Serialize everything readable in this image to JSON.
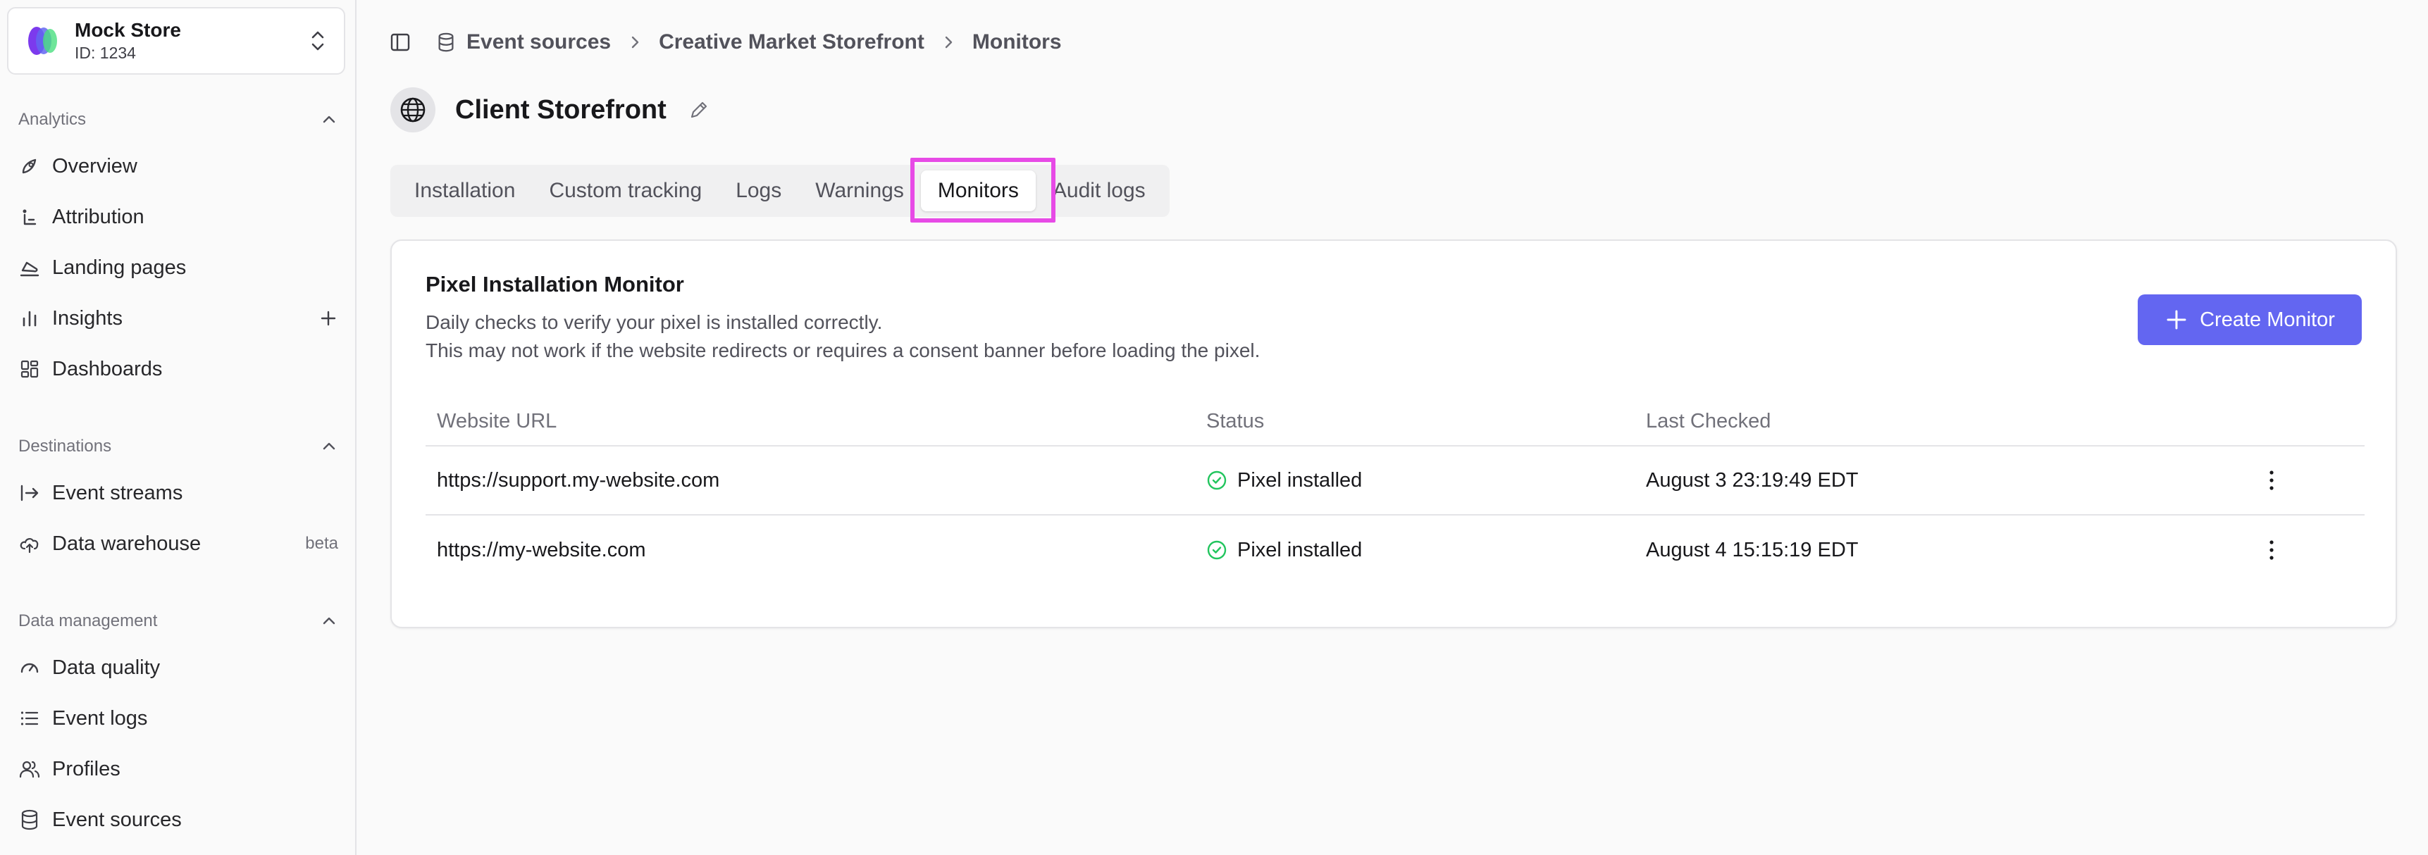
{
  "store": {
    "name": "Mock Store",
    "id_label": "ID: 1234"
  },
  "sidebar": {
    "sections": [
      {
        "label": "Analytics",
        "items": [
          {
            "label": "Overview",
            "icon": "rocket-icon"
          },
          {
            "label": "Attribution",
            "icon": "attribution-icon"
          },
          {
            "label": "Landing pages",
            "icon": "landing-icon"
          },
          {
            "label": "Insights",
            "icon": "bar-chart-icon"
          },
          {
            "label": "Dashboards",
            "icon": "dashboard-icon"
          }
        ]
      },
      {
        "label": "Destinations",
        "items": [
          {
            "label": "Event streams",
            "icon": "arrow-right-icon"
          },
          {
            "label": "Data warehouse",
            "icon": "cloud-upload-icon",
            "badge": "beta"
          }
        ]
      },
      {
        "label": "Data management",
        "items": [
          {
            "label": "Data quality",
            "icon": "gauge-icon"
          },
          {
            "label": "Event logs",
            "icon": "list-icon"
          },
          {
            "label": "Profiles",
            "icon": "users-icon"
          },
          {
            "label": "Event sources",
            "icon": "database-icon"
          }
        ]
      }
    ]
  },
  "breadcrumb": [
    "Event sources",
    "Creative Market Storefront",
    "Monitors"
  ],
  "page": {
    "title": "Client Storefront"
  },
  "tabs": [
    "Installation",
    "Custom tracking",
    "Logs",
    "Warnings",
    "Monitors",
    "Audit logs"
  ],
  "active_tab": "Monitors",
  "monitor": {
    "title": "Pixel Installation Monitor",
    "description_line1": "Daily checks to verify your pixel is installed correctly.",
    "description_line2": "This may not work if the website redirects or requires a consent banner before loading the pixel.",
    "create_button": "Create Monitor",
    "columns": {
      "url": "Website URL",
      "status": "Status",
      "last_checked": "Last Checked"
    },
    "rows": [
      {
        "url": "https://support.my-website.com",
        "status": "Pixel installed",
        "last_checked": "August 3 23:19:49 EDT"
      },
      {
        "url": "https://my-website.com",
        "status": "Pixel installed",
        "last_checked": "August 4 15:15:19 EDT"
      }
    ]
  },
  "colors": {
    "accent": "#6366f1",
    "success": "#22c55e",
    "highlight": "#e74ae6"
  }
}
